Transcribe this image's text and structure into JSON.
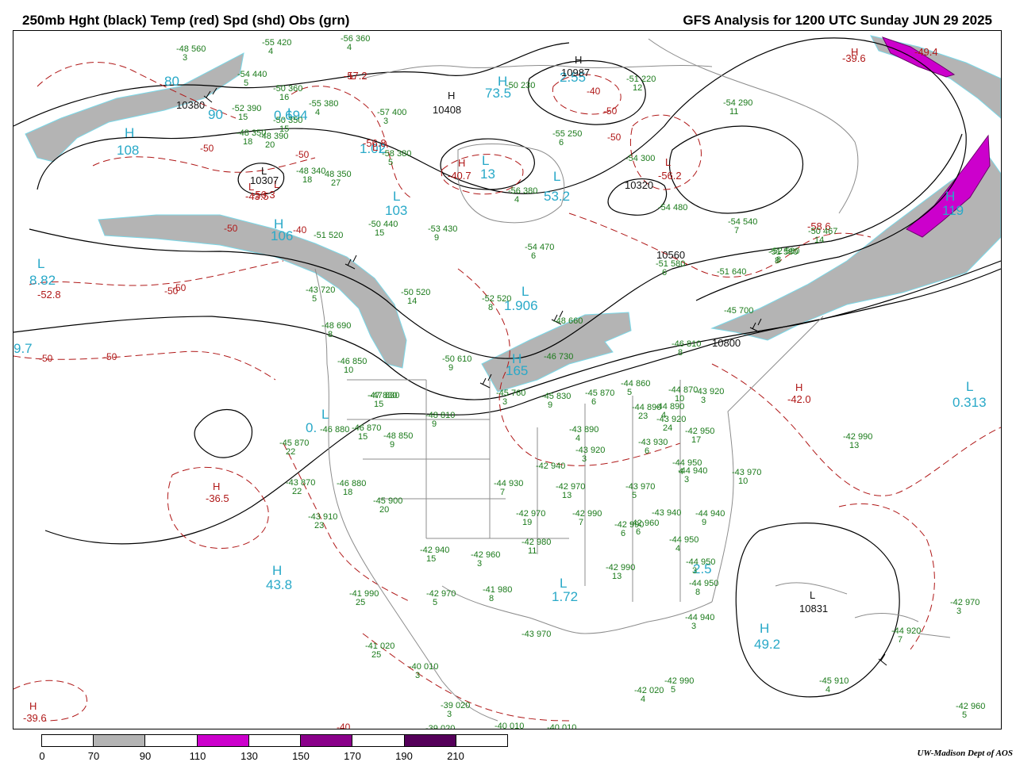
{
  "header": {
    "left_title": "250mb Hght (black) Temp (red) Spd (shd) Obs (grn)",
    "right_title": "GFS Analysis for 1200 UTC Sunday  JUN 29 2025"
  },
  "colors": {
    "height_contours": "#000000",
    "temperature_contours": "#b01818",
    "observations": "#1a7a1a",
    "speed_labels": "#29a9c8",
    "shade_70_90": "#b4b4b4",
    "shade_110_130": "#cc00cc"
  },
  "system_labels": [
    {
      "t": "H",
      "c": "blue"
    },
    {
      "t": "108",
      "c": "blue"
    },
    {
      "t": "L",
      "c": "blue"
    },
    {
      "t": "0.694",
      "c": "blue"
    },
    {
      "t": "L",
      "c": "blue"
    },
    {
      "t": "1.02",
      "c": "blue"
    },
    {
      "t": "L",
      "c": "blue"
    },
    {
      "t": "103",
      "c": "blue"
    },
    {
      "t": "H",
      "c": "blue"
    },
    {
      "t": "106",
      "c": "blue"
    },
    {
      "t": "L",
      "c": "blue"
    },
    {
      "t": "8.82",
      "c": "blue"
    },
    {
      "t": "9.7",
      "c": "blue"
    },
    {
      "t": "L",
      "c": "blue"
    },
    {
      "t": "0.",
      "c": "blue"
    },
    {
      "t": "H",
      "c": "blue"
    },
    {
      "t": "43.8",
      "c": "blue"
    },
    {
      "t": "L",
      "c": "blue"
    },
    {
      "t": "1.906",
      "c": "blue"
    },
    {
      "t": "H",
      "c": "blue"
    },
    {
      "t": "165",
      "c": "blue"
    },
    {
      "t": "L",
      "c": "blue"
    },
    {
      "t": "1.72",
      "c": "blue"
    },
    {
      "t": "L",
      "c": "blue"
    },
    {
      "t": "0.313",
      "c": "blue"
    },
    {
      "t": "H",
      "c": "blue"
    },
    {
      "t": "49.2",
      "c": "blue"
    },
    {
      "t": "H",
      "c": "blue"
    },
    {
      "t": "119",
      "c": "blue"
    },
    {
      "t": "L",
      "c": "blue"
    },
    {
      "t": "13",
      "c": "blue"
    },
    {
      "t": "L",
      "c": "blue"
    },
    {
      "t": "53.2",
      "c": "blue"
    },
    {
      "t": "H",
      "c": "blue"
    },
    {
      "t": "73.5",
      "c": "blue"
    },
    {
      "t": "2.55",
      "c": "blue"
    },
    {
      "t": "2.5",
      "c": "blue"
    },
    {
      "t": "80",
      "c": "blue"
    },
    {
      "t": "90",
      "c": "blue"
    },
    {
      "t": "H",
      "c": "red"
    },
    {
      "t": "-40.7",
      "c": "red"
    },
    {
      "t": "L",
      "c": "red"
    },
    {
      "t": "-56.3",
      "c": "red"
    },
    {
      "t": "L",
      "c": "red"
    },
    {
      "t": "-56.2",
      "c": "red"
    },
    {
      "t": "-52.8",
      "c": "red"
    },
    {
      "t": "L",
      "c": "red"
    },
    {
      "t": "-43.5",
      "c": "red"
    },
    {
      "t": "H",
      "c": "red"
    },
    {
      "t": "-36.5",
      "c": "red"
    },
    {
      "t": "H",
      "c": "red"
    },
    {
      "t": "-42.0",
      "c": "red"
    },
    {
      "t": "H",
      "c": "red"
    },
    {
      "t": "-39.6",
      "c": "red"
    },
    {
      "t": "H",
      "c": "red"
    },
    {
      "t": "-39.6",
      "c": "red"
    },
    {
      "t": "L",
      "c": "red"
    },
    {
      "t": "-57.2",
      "c": "red"
    },
    {
      "t": "L",
      "c": "red"
    },
    {
      "t": "-56.8",
      "c": "red"
    },
    {
      "t": "-58.6",
      "c": "red"
    },
    {
      "t": "-49.4",
      "c": "red"
    },
    {
      "t": "L",
      "c": "black"
    },
    {
      "t": "10307",
      "c": "black"
    },
    {
      "t": "H",
      "c": "black"
    },
    {
      "t": "10408",
      "c": "black"
    },
    {
      "t": "H",
      "c": "black"
    },
    {
      "t": "10987",
      "c": "black"
    },
    {
      "t": "L",
      "c": "black"
    },
    {
      "t": "10831",
      "c": "black"
    },
    {
      "t": "10320",
      "c": "black"
    },
    {
      "t": "10560",
      "c": "black"
    },
    {
      "t": "10800",
      "c": "black"
    },
    {
      "t": "10380",
      "c": "black"
    }
  ],
  "contour_labels": [
    "-50",
    "-50",
    "-50",
    "-50",
    "-50",
    "-50",
    "-50",
    "-50",
    "-40",
    "-40",
    "-50",
    "-40"
  ],
  "observations": [
    {
      "temp": "-48",
      "hgt": "560",
      "dew": "3"
    },
    {
      "temp": "-55",
      "hgt": "420",
      "dew": "4"
    },
    {
      "temp": "-56",
      "hgt": "360",
      "dew": "4"
    },
    {
      "temp": "-54",
      "hgt": "440",
      "dew": "5"
    },
    {
      "temp": "-50",
      "hgt": "360",
      "dew": "16"
    },
    {
      "temp": "-55",
      "hgt": "380",
      "dew": "4"
    },
    {
      "temp": "-52",
      "hgt": "390",
      "dew": "15"
    },
    {
      "temp": "-50",
      "hgt": "350",
      "dew": "15"
    },
    {
      "temp": "-57",
      "hgt": "400",
      "dew": "3"
    },
    {
      "temp": "-48",
      "hgt": "350",
      "dew": "18"
    },
    {
      "temp": "-58",
      "hgt": "380",
      "dew": "5"
    },
    {
      "temp": "-48",
      "hgt": "390",
      "dew": "20"
    },
    {
      "temp": "-48",
      "hgt": "340",
      "dew": "18"
    },
    {
      "temp": "48",
      "hgt": "350",
      "dew": "27"
    },
    {
      "temp": "-55",
      "hgt": "250",
      "dew": "6"
    },
    {
      "temp": "-50",
      "hgt": "230",
      "dew": ""
    },
    {
      "temp": "-51",
      "hgt": "220",
      "dew": "12"
    },
    {
      "temp": "-54",
      "hgt": "290",
      "dew": "11"
    },
    {
      "temp": "-54",
      "hgt": "300",
      "dew": ""
    },
    {
      "temp": "-56",
      "hgt": "380",
      "dew": "4"
    },
    {
      "temp": "-54",
      "hgt": "480",
      "dew": ""
    },
    {
      "temp": "-54",
      "hgt": "540",
      "dew": "7"
    },
    {
      "temp": "-53",
      "hgt": "430",
      "dew": "9"
    },
    {
      "temp": "-50",
      "hgt": "440",
      "dew": "15"
    },
    {
      "temp": "-51",
      "hgt": "520",
      "dew": ""
    },
    {
      "temp": "-54",
      "hgt": "470",
      "dew": "6"
    },
    {
      "temp": "-51",
      "hgt": "580",
      "dew": "6"
    },
    {
      "temp": "-52",
      "hgt": "580",
      "dew": "8"
    },
    {
      "temp": "-51",
      "hgt": "640",
      "dew": ""
    },
    {
      "temp": "-50",
      "hgt": "467",
      "dew": "14"
    },
    {
      "temp": "-51",
      "hgt": "580",
      "dew": "8"
    },
    {
      "temp": "-43",
      "hgt": "720",
      "dew": "5"
    },
    {
      "temp": "-50",
      "hgt": "520",
      "dew": "14"
    },
    {
      "temp": "-52",
      "hgt": "520",
      "dew": "8"
    },
    {
      "temp": "-48",
      "hgt": "660",
      "dew": ""
    },
    {
      "temp": "-45",
      "hgt": "700",
      "dew": ""
    },
    {
      "temp": "-48",
      "hgt": "690",
      "dew": "8"
    },
    {
      "temp": "-46",
      "hgt": "850",
      "dew": "10"
    },
    {
      "temp": "-50",
      "hgt": "610",
      "dew": "9"
    },
    {
      "temp": "-46",
      "hgt": "730",
      "dew": ""
    },
    {
      "temp": "-46",
      "hgt": "810",
      "dew": "8"
    },
    {
      "temp": "-47",
      "hgt": "830",
      "dew": ""
    },
    {
      "temp": "-47",
      "hgt": "830",
      "dew": "15"
    },
    {
      "temp": "-45",
      "hgt": "760",
      "dew": "3"
    },
    {
      "temp": "-45",
      "hgt": "830",
      "dew": "9"
    },
    {
      "temp": "-45",
      "hgt": "870",
      "dew": "6"
    },
    {
      "temp": "-44",
      "hgt": "860",
      "dew": "5"
    },
    {
      "temp": "-44",
      "hgt": "870",
      "dew": "10"
    },
    {
      "temp": "-44",
      "hgt": "890",
      "dew": "4"
    },
    {
      "temp": "-43",
      "hgt": "920",
      "dew": "3"
    },
    {
      "temp": "-48",
      "hgt": "810",
      "dew": "9"
    },
    {
      "temp": "-46",
      "hgt": "880",
      "dew": ""
    },
    {
      "temp": "-46",
      "hgt": "870",
      "dew": "15"
    },
    {
      "temp": "-48",
      "hgt": "850",
      "dew": "9"
    },
    {
      "temp": "-45",
      "hgt": "870",
      "dew": "22"
    },
    {
      "temp": "-43",
      "hgt": "890",
      "dew": "4"
    },
    {
      "temp": "-44",
      "hgt": "890",
      "dew": "23"
    },
    {
      "temp": "-43",
      "hgt": "920",
      "dew": "24"
    },
    {
      "temp": "-42",
      "hgt": "950",
      "dew": "17"
    },
    {
      "temp": "-43",
      "hgt": "920",
      "dew": "3"
    },
    {
      "temp": "-43",
      "hgt": "930",
      "dew": "6"
    },
    {
      "temp": "-42",
      "hgt": "990",
      "dew": "13"
    },
    {
      "temp": "-43",
      "hgt": "870",
      "dew": "22"
    },
    {
      "temp": "-46",
      "hgt": "880",
      "dew": "18"
    },
    {
      "temp": "-45",
      "hgt": "900",
      "dew": "20"
    },
    {
      "temp": "-42",
      "hgt": "940",
      "dew": ""
    },
    {
      "temp": "-44",
      "hgt": "930",
      "dew": "7"
    },
    {
      "temp": "-42",
      "hgt": "970",
      "dew": "13"
    },
    {
      "temp": "-43",
      "hgt": "970",
      "dew": "5"
    },
    {
      "temp": "-44",
      "hgt": "950",
      "dew": "4"
    },
    {
      "temp": "-44",
      "hgt": "940",
      "dew": "3"
    },
    {
      "temp": "-43",
      "hgt": "970",
      "dew": "10"
    },
    {
      "temp": "-43",
      "hgt": "910",
      "dew": "23"
    },
    {
      "temp": "-42",
      "hgt": "970",
      "dew": "19"
    },
    {
      "temp": "-42",
      "hgt": "990",
      "dew": "7"
    },
    {
      "temp": "-42",
      "hgt": "960",
      "dew": "6"
    },
    {
      "temp": "-43",
      "hgt": "940",
      "dew": ""
    },
    {
      "temp": "-44",
      "hgt": "940",
      "dew": "9"
    },
    {
      "temp": "-42",
      "hgt": "980",
      "dew": "11"
    },
    {
      "temp": "-42",
      "hgt": "990",
      "dew": "6"
    },
    {
      "temp": "-44",
      "hgt": "950",
      "dew": "4"
    },
    {
      "temp": "-44",
      "hgt": "950",
      "dew": "3"
    },
    {
      "temp": "-42",
      "hgt": "940",
      "dew": "15"
    },
    {
      "temp": "-42",
      "hgt": "960",
      "dew": "3"
    },
    {
      "temp": "-42",
      "hgt": "990",
      "dew": "13"
    },
    {
      "temp": "-44",
      "hgt": "950",
      "dew": "8"
    },
    {
      "temp": "-41",
      "hgt": "990",
      "dew": "25"
    },
    {
      "temp": "-42",
      "hgt": "970",
      "dew": "5"
    },
    {
      "temp": "-41",
      "hgt": "980",
      "dew": "8"
    },
    {
      "temp": "-44",
      "hgt": "940",
      "dew": "3"
    },
    {
      "temp": "-42",
      "hgt": "970",
      "dew": "3"
    },
    {
      "temp": "-41",
      "hgt": "020",
      "dew": "25"
    },
    {
      "temp": "-43",
      "hgt": "970",
      "dew": ""
    },
    {
      "temp": "-44",
      "hgt": "920",
      "dew": "7"
    },
    {
      "temp": "-40",
      "hgt": "010",
      "dew": "3"
    },
    {
      "temp": "-42",
      "hgt": "020",
      "dew": "4"
    },
    {
      "temp": "-42",
      "hgt": "990",
      "dew": "5"
    },
    {
      "temp": "-45",
      "hgt": "910",
      "dew": "4"
    },
    {
      "temp": "-39",
      "hgt": "020",
      "dew": "3"
    },
    {
      "temp": "-39",
      "hgt": "020",
      "dew": ""
    },
    {
      "temp": "-40",
      "hgt": "010",
      "dew": ""
    },
    {
      "temp": "-40",
      "hgt": "010",
      "dew": ""
    },
    {
      "temp": "-42",
      "hgt": "960",
      "dew": "5"
    }
  ],
  "legend": {
    "ticks": [
      "0",
      "70",
      "90",
      "110",
      "130",
      "150",
      "170",
      "190",
      "210"
    ],
    "bin_colors": [
      "#ffffff",
      "#b4b4b4",
      "#ffffff",
      "#cc00cc",
      "#ffffff",
      "#8a008a",
      "#ffffff",
      "#55005a",
      "#ffffff"
    ]
  },
  "credit": "UW-Madison  Dept of AOS"
}
